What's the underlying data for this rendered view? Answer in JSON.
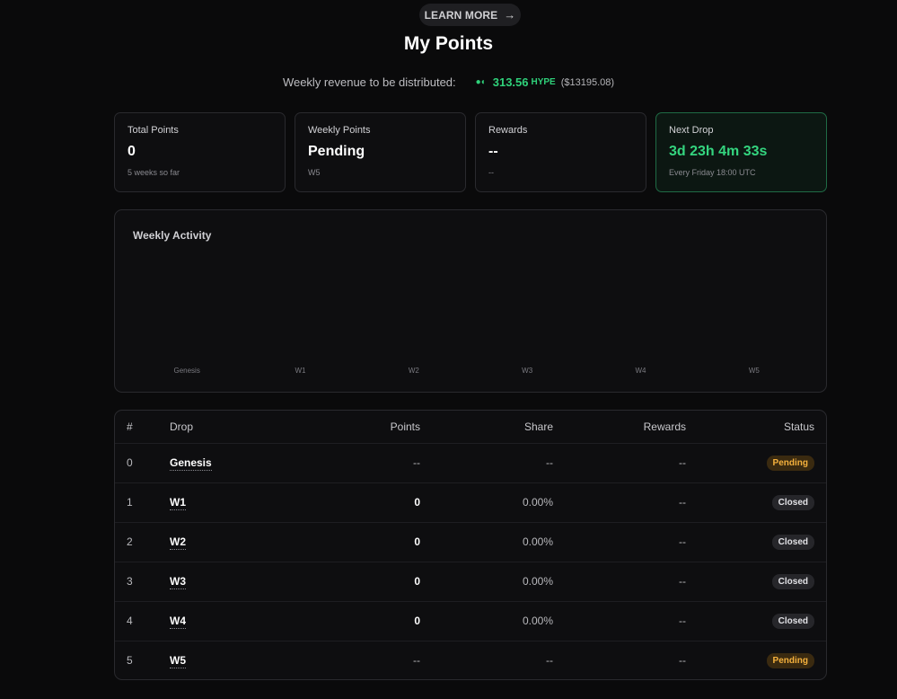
{
  "header": {
    "learn_more_label": "LEARN MORE",
    "title": "My Points"
  },
  "revenue": {
    "label": "Weekly revenue to be distributed:",
    "amount": "313.56",
    "unit": "HYPE",
    "usd": "($13195.08)",
    "accent_color": "#2fd17a"
  },
  "cards": [
    {
      "label": "Total Points",
      "value": "0",
      "sub": "5 weeks so far"
    },
    {
      "label": "Weekly Points",
      "value": "Pending",
      "sub": "W5"
    },
    {
      "label": "Rewards",
      "value": "--",
      "sub": "--"
    },
    {
      "label": "Next Drop",
      "value": "3d 23h 4m 33s",
      "sub": "Every Friday 18:00 UTC"
    }
  ],
  "activity": {
    "title": "Weekly Activity",
    "chart_data": {
      "type": "bar",
      "title": "Weekly Activity",
      "categories": [
        "Genesis",
        "W1",
        "W2",
        "W3",
        "W4",
        "W5"
      ],
      "values": [
        0,
        0,
        0,
        0,
        0,
        0
      ],
      "xlabel": "",
      "ylabel": ""
    }
  },
  "table": {
    "headers": {
      "idx": "#",
      "drop": "Drop",
      "points": "Points",
      "share": "Share",
      "rewards": "Rewards",
      "status": "Status"
    },
    "rows": [
      {
        "idx": "0",
        "drop": "Genesis",
        "points": "--",
        "share": "--",
        "rewards": "--",
        "status": "Pending"
      },
      {
        "idx": "1",
        "drop": "W1",
        "points": "0",
        "share": "0.00%",
        "rewards": "--",
        "status": "Closed"
      },
      {
        "idx": "2",
        "drop": "W2",
        "points": "0",
        "share": "0.00%",
        "rewards": "--",
        "status": "Closed"
      },
      {
        "idx": "3",
        "drop": "W3",
        "points": "0",
        "share": "0.00%",
        "rewards": "--",
        "status": "Closed"
      },
      {
        "idx": "4",
        "drop": "W4",
        "points": "0",
        "share": "0.00%",
        "rewards": "--",
        "status": "Closed"
      },
      {
        "idx": "5",
        "drop": "W5",
        "points": "--",
        "share": "--",
        "rewards": "--",
        "status": "Pending"
      }
    ]
  },
  "colors": {
    "pending": "#f5b13d",
    "closed": "#e2e2e6",
    "next_drop": "#34d57f"
  }
}
